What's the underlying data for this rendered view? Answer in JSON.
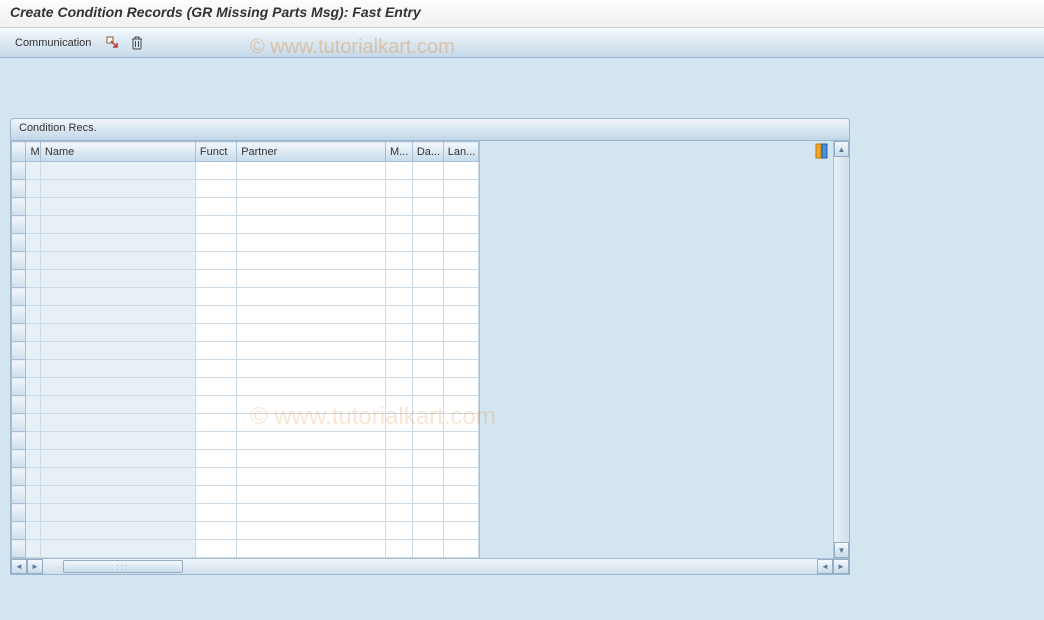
{
  "title": "Create Condition Records (GR Missing Parts Msg): Fast Entry",
  "toolbar": {
    "communication_label": "Communication"
  },
  "panel": {
    "header": "Condition Recs."
  },
  "columns": {
    "sel": "",
    "m": "M",
    "name": "Name",
    "funct": "Funct",
    "partner": "Partner",
    "medium": "M...",
    "date": "Da...",
    "language": "Lan..."
  },
  "rows": [
    {
      "m": "",
      "name": "",
      "funct": "",
      "partner": "",
      "medium": "",
      "date": "",
      "language": ""
    },
    {
      "m": "",
      "name": "",
      "funct": "",
      "partner": "",
      "medium": "",
      "date": "",
      "language": ""
    },
    {
      "m": "",
      "name": "",
      "funct": "",
      "partner": "",
      "medium": "",
      "date": "",
      "language": ""
    },
    {
      "m": "",
      "name": "",
      "funct": "",
      "partner": "",
      "medium": "",
      "date": "",
      "language": ""
    },
    {
      "m": "",
      "name": "",
      "funct": "",
      "partner": "",
      "medium": "",
      "date": "",
      "language": ""
    },
    {
      "m": "",
      "name": "",
      "funct": "",
      "partner": "",
      "medium": "",
      "date": "",
      "language": ""
    },
    {
      "m": "",
      "name": "",
      "funct": "",
      "partner": "",
      "medium": "",
      "date": "",
      "language": ""
    },
    {
      "m": "",
      "name": "",
      "funct": "",
      "partner": "",
      "medium": "",
      "date": "",
      "language": ""
    },
    {
      "m": "",
      "name": "",
      "funct": "",
      "partner": "",
      "medium": "",
      "date": "",
      "language": ""
    },
    {
      "m": "",
      "name": "",
      "funct": "",
      "partner": "",
      "medium": "",
      "date": "",
      "language": ""
    },
    {
      "m": "",
      "name": "",
      "funct": "",
      "partner": "",
      "medium": "",
      "date": "",
      "language": ""
    },
    {
      "m": "",
      "name": "",
      "funct": "",
      "partner": "",
      "medium": "",
      "date": "",
      "language": ""
    },
    {
      "m": "",
      "name": "",
      "funct": "",
      "partner": "",
      "medium": "",
      "date": "",
      "language": ""
    },
    {
      "m": "",
      "name": "",
      "funct": "",
      "partner": "",
      "medium": "",
      "date": "",
      "language": ""
    },
    {
      "m": "",
      "name": "",
      "funct": "",
      "partner": "",
      "medium": "",
      "date": "",
      "language": ""
    },
    {
      "m": "",
      "name": "",
      "funct": "",
      "partner": "",
      "medium": "",
      "date": "",
      "language": ""
    },
    {
      "m": "",
      "name": "",
      "funct": "",
      "partner": "",
      "medium": "",
      "date": "",
      "language": ""
    },
    {
      "m": "",
      "name": "",
      "funct": "",
      "partner": "",
      "medium": "",
      "date": "",
      "language": ""
    },
    {
      "m": "",
      "name": "",
      "funct": "",
      "partner": "",
      "medium": "",
      "date": "",
      "language": ""
    },
    {
      "m": "",
      "name": "",
      "funct": "",
      "partner": "",
      "medium": "",
      "date": "",
      "language": ""
    },
    {
      "m": "",
      "name": "",
      "funct": "",
      "partner": "",
      "medium": "",
      "date": "",
      "language": ""
    },
    {
      "m": "",
      "name": "",
      "funct": "",
      "partner": "",
      "medium": "",
      "date": "",
      "language": ""
    }
  ],
  "watermark": "© www.tutorialkart.com"
}
